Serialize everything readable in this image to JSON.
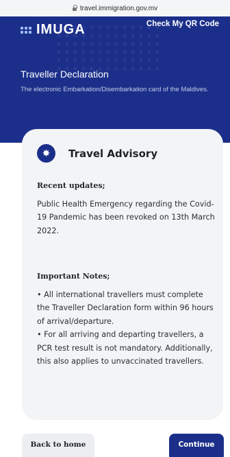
{
  "browser": {
    "url": "travel.immigration.gov.mv"
  },
  "header": {
    "logo_text": "IMUGA",
    "qr_link": "Check My QR Code"
  },
  "hero": {
    "title": "Traveller Declaration",
    "subtitle": "The electronic Embarkation/Disembarkation card of the Maldives."
  },
  "advisory": {
    "title": "Travel Advisory",
    "icon": "sun-icon",
    "recent_title": "Recent updates;",
    "recent_body": "Public Health Emergency regarding the Covid-19 Pandemic has been revoked on 13th March 2022.",
    "notes_title": "Important Notes;",
    "notes": [
      "• All international travellers must complete the Traveller Declaration form within 96 hours of arrival/departure.",
      "• For all arriving and departing travellers, a PCR test result is not mandatory. Additionally, this also applies to unvaccinated travellers."
    ]
  },
  "buttons": {
    "back": "Back to home",
    "continue": "Continue"
  },
  "colors": {
    "brand": "#1b2f8a",
    "card_bg": "#f3f4f6",
    "button_secondary": "#eceef1"
  }
}
